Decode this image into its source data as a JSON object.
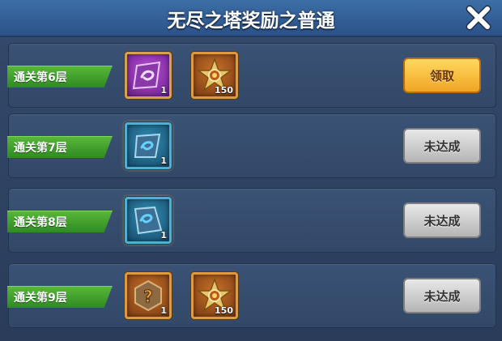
{
  "header": {
    "title": "无尽之塔奖励之普通",
    "close_icon": "close-icon"
  },
  "rows": [
    {
      "label": "通关第6层",
      "button": "领取",
      "button_state": "claim",
      "items": [
        {
          "icon": "purple-gem-icon",
          "frame": "purple",
          "qty": "1"
        },
        {
          "icon": "star-medal-icon",
          "frame": "orange",
          "qty": "150"
        }
      ]
    },
    {
      "label": "通关第7层",
      "button": "未达成",
      "button_state": "locked",
      "items": [
        {
          "icon": "blue-gem-icon",
          "frame": "blue",
          "qty": "1"
        }
      ]
    },
    {
      "label": "通关第8层",
      "button": "未达成",
      "button_state": "locked",
      "items": [
        {
          "icon": "blue-gem-icon",
          "frame": "blue",
          "qty": "1"
        }
      ]
    },
    {
      "label": "通关第9层",
      "button": "未达成",
      "button_state": "locked",
      "items": [
        {
          "icon": "mystery-box-icon",
          "frame": "orange",
          "qty": "1"
        },
        {
          "icon": "star-medal-icon",
          "frame": "orange",
          "qty": "150"
        }
      ]
    }
  ],
  "colors": {
    "header": "#3d6ea6",
    "panel": "#324868",
    "ribbon": "#3a9e2a",
    "claim": "#f5b52f",
    "locked": "#c8c8c8"
  }
}
